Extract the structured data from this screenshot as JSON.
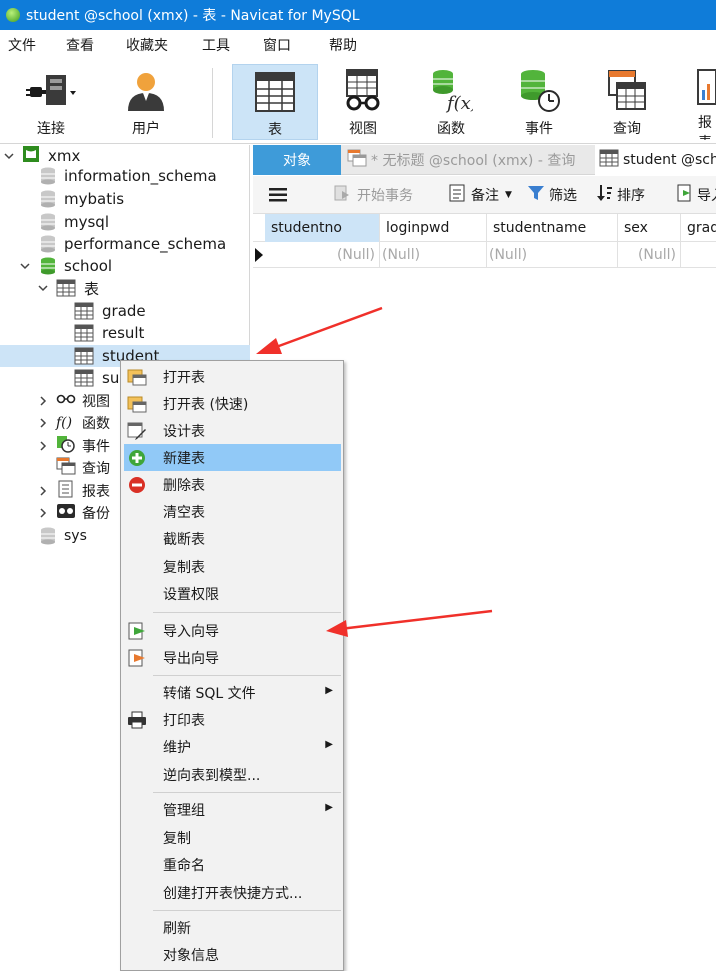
{
  "window": {
    "title": "student @school (xmx) - 表 - Navicat for MySQL"
  },
  "menubar": [
    "文件",
    "查看",
    "收藏夹",
    "工具",
    "窗口",
    "帮助"
  ],
  "toolbar": {
    "connect": "连接",
    "user": "用户",
    "table": "表",
    "view": "视图",
    "function": "函数",
    "event": "事件",
    "query": "查询",
    "report": "报表"
  },
  "tree": {
    "connection": "xmx",
    "databases": [
      "information_schema",
      "mybatis",
      "mysql",
      "performance_schema"
    ],
    "school": "school",
    "tables_node": "表",
    "tables": [
      "grade",
      "result",
      "student",
      "subject"
    ],
    "view": "视图",
    "function": "函数",
    "event": "事件",
    "query": "查询",
    "report": "报表",
    "backup": "备份",
    "sys": "sys"
  },
  "tabs": {
    "objects": "对象",
    "untitled_query": "* 无标题 @school (xmx) - 查询",
    "student_table": "student @school"
  },
  "grid_toolbar": {
    "begin_transaction": "开始事务",
    "memo": "备注",
    "filter": "筛选",
    "sort": "排序",
    "import": "导入"
  },
  "grid": {
    "columns": [
      "studentno",
      "loginpwd",
      "studentname",
      "sex",
      "gradeid"
    ],
    "row": [
      "(Null)",
      "(Null)",
      "(Null)",
      "(Null)"
    ]
  },
  "context_menu": {
    "open_table": "打开表",
    "open_table_fast": "打开表 (快速)",
    "design_table": "设计表",
    "new_table": "新建表",
    "delete_table": "删除表",
    "empty_table": "清空表",
    "truncate_table": "截断表",
    "duplicate_table": "复制表",
    "set_permissions": "设置权限",
    "import_wizard": "导入向导",
    "export_wizard": "导出向导",
    "dump_sql": "转储 SQL 文件",
    "print_table": "打印表",
    "maintain": "维护",
    "reverse_to_model": "逆向表到模型...",
    "manage_group": "管理组",
    "copy": "复制",
    "rename": "重命名",
    "create_shortcut": "创建打开表快捷方式...",
    "refresh": "刷新",
    "object_info": "对象信息"
  },
  "colors": {
    "titlebar": "#0f7cd9",
    "selection": "#cde4f7",
    "menu_highlight": "#91c9f7",
    "annotation_arrow": "#f0302a"
  }
}
